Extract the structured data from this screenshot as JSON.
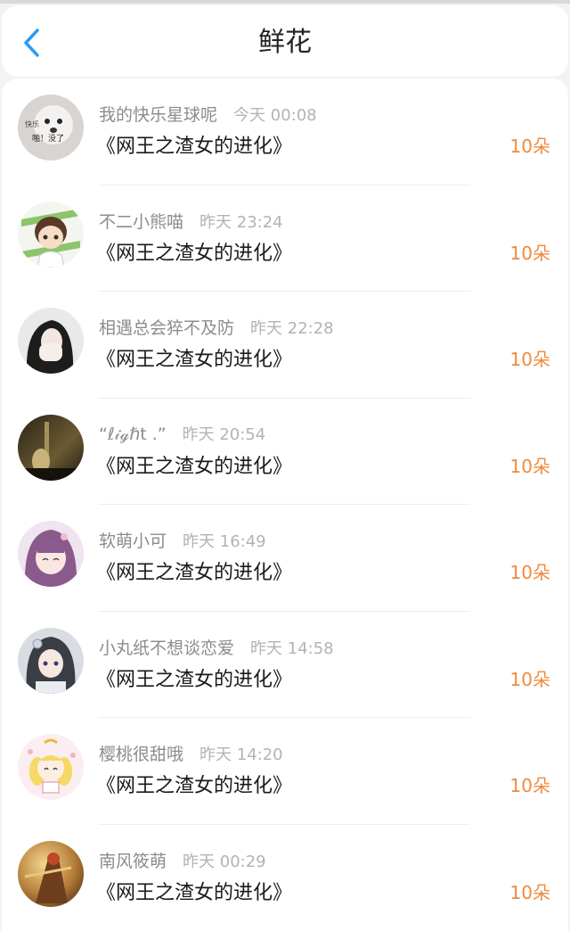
{
  "header": {
    "title": "鲜花",
    "back_icon": "chevron-left-icon",
    "accent_color": "#2b9cf2"
  },
  "colors": {
    "count": "#f08a3c",
    "name": "#8c8c8c",
    "time": "#b3b3b3"
  },
  "items": [
    {
      "name": "我的快乐星球呢",
      "time": "今天 00:08",
      "book": "《网王之渣女的进化》",
      "count": "10朵",
      "avatar_badge": "快乐",
      "avatar_text": "啪！没了"
    },
    {
      "name": "不二小熊喵",
      "time": "昨天 23:24",
      "book": "《网王之渣女的进化》",
      "count": "10朵"
    },
    {
      "name": "相遇总会猝不及防",
      "time": "昨天 22:28",
      "book": "《网王之渣女的进化》",
      "count": "10朵"
    },
    {
      "name": "“ℓ𝒾ℊℏt .”",
      "time": "昨天 20:54",
      "book": "《网王之渣女的进化》",
      "count": "10朵"
    },
    {
      "name": "软萌小可",
      "time": "昨天 16:49",
      "book": "《网王之渣女的进化》",
      "count": "10朵"
    },
    {
      "name": "小丸纸不想谈恋爱",
      "time": "昨天 14:58",
      "book": "《网王之渣女的进化》",
      "count": "10朵"
    },
    {
      "name": "樱桃很甜哦",
      "time": "昨天 14:20",
      "book": "《网王之渣女的进化》",
      "count": "10朵"
    },
    {
      "name": "南风筱萌",
      "time": "昨天 00:29",
      "book": "《网王之渣女的进化》",
      "count": "10朵"
    }
  ]
}
